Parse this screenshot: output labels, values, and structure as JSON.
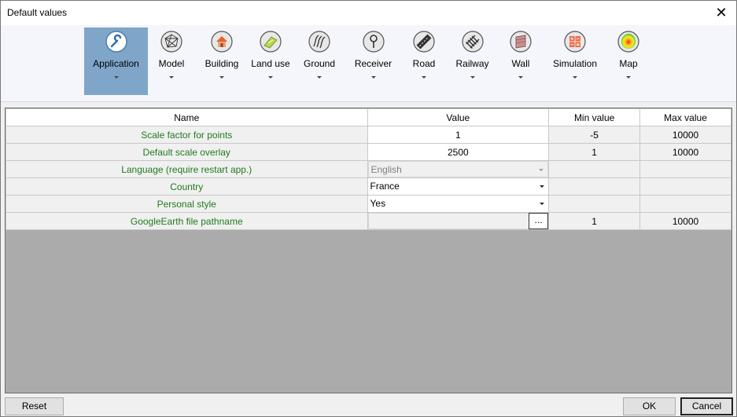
{
  "window": {
    "title": "Default values"
  },
  "toolbar": [
    {
      "label": "Application",
      "icon": "wrench-icon",
      "active": true
    },
    {
      "label": "Model",
      "icon": "mesh-icon",
      "active": false
    },
    {
      "label": "Building",
      "icon": "house-icon",
      "active": false
    },
    {
      "label": "Land use",
      "icon": "land-use-icon",
      "active": false
    },
    {
      "label": "Ground",
      "icon": "ground-icon",
      "active": false
    },
    {
      "label": "Receiver",
      "icon": "receiver-icon",
      "active": false
    },
    {
      "label": "Road",
      "icon": "road-icon",
      "active": false
    },
    {
      "label": "Railway",
      "icon": "railway-icon",
      "active": false
    },
    {
      "label": "Wall",
      "icon": "wall-icon",
      "active": false
    },
    {
      "label": "Simulation",
      "icon": "calculator-icon",
      "active": false
    },
    {
      "label": "Map",
      "icon": "map-icon",
      "active": false
    }
  ],
  "grid": {
    "columns": [
      "Name",
      "Value",
      "Min value",
      "Max value"
    ],
    "rows": [
      {
        "name": "Scale factor for points",
        "value": "1",
        "min": "-5",
        "max": "10000"
      },
      {
        "name": "Default scale overlay",
        "value": "2500",
        "min": "1",
        "max": "10000"
      },
      {
        "name": "Language (require restart app.)",
        "value": "English",
        "min": "",
        "max": ""
      },
      {
        "name": "Country",
        "value": "France",
        "min": "",
        "max": ""
      },
      {
        "name": "Personal style",
        "value": "Yes",
        "min": "",
        "max": ""
      },
      {
        "name": "GoogleEarth file pathname",
        "value": "",
        "browse": "...",
        "min": "1",
        "max": "10000"
      }
    ]
  },
  "buttons": {
    "reset": "Reset",
    "ok": "OK",
    "cancel": "Cancel"
  },
  "colors": {
    "active_tool": "#7fa6c8",
    "name_text": "#1f7a1f",
    "grid_background": "#ababab"
  }
}
